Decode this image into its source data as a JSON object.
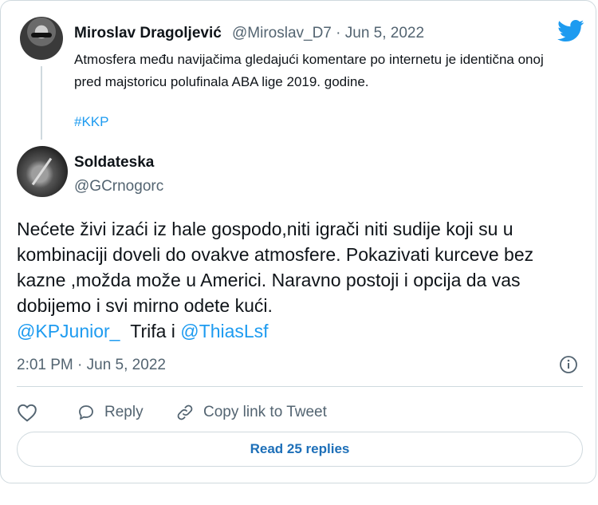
{
  "quoted": {
    "name": "Miroslav Dragoljević",
    "handle_date": "@Miroslav_D7 · Jun 5, 2022",
    "text": "Atmosfera među navijačima gledajući komentare po internetu je identična onoj pred majstoricu polufinala ABA lige 2019. godine.",
    "hashtag": "#KKP"
  },
  "tweet": {
    "name": "Soldateska",
    "handle": "@GCrnogorc",
    "body": "Nećete živi izaći iz hale gospodo,niti igrači niti sudije koji su u kombinaciji doveli do ovakve atmosfere. Pokazivati kurceve bez kazne ,možda može u Americi. Naravno postoji i opcija da vas dobijemo i svi mirno odete kući.",
    "mention1": "@KPJunior_",
    "between": "Trifa i",
    "mention2": "@ThiasLsf",
    "timestamp": "2:01 PM · Jun 5, 2022"
  },
  "actions": {
    "like_icon": "heart-icon",
    "reply_label": "Reply",
    "copy_label": "Copy link to Tweet",
    "read_replies": "Read 25 replies"
  },
  "colors": {
    "brand": "#1d9bf0",
    "secondary_text": "#536471",
    "border": "#cfd9de"
  }
}
